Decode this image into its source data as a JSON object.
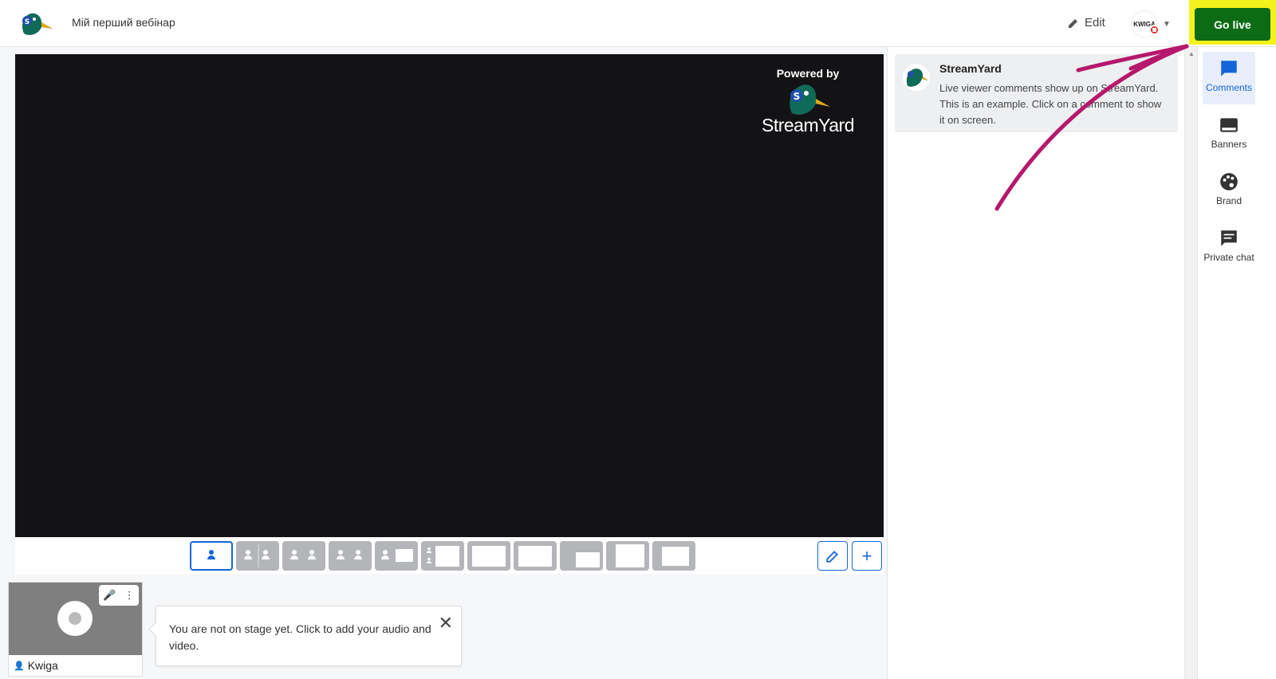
{
  "header": {
    "title": "Мій перший вебінар",
    "edit_label": "Edit",
    "destination_label": "KWIGA",
    "go_live_label": "Go live"
  },
  "stage": {
    "powered_by": "Powered by",
    "brand": "StreamYard"
  },
  "participant": {
    "name": "Kwiga"
  },
  "tooltip": {
    "text": "You are not on stage yet. Click to add your audio and video."
  },
  "comments": [
    {
      "author": "StreamYard",
      "text": "Live viewer comments show up on StreamYard. This is an example. Click on a comment to show it on screen."
    }
  ],
  "rail": {
    "comments": "Comments",
    "banners": "Banners",
    "brand": "Brand",
    "private_chat": "Private chat"
  },
  "colors": {
    "go_live": "#0c6b14",
    "highlight": "#f3f21a",
    "accent": "#1565d8",
    "annotation": "#b5186c"
  }
}
